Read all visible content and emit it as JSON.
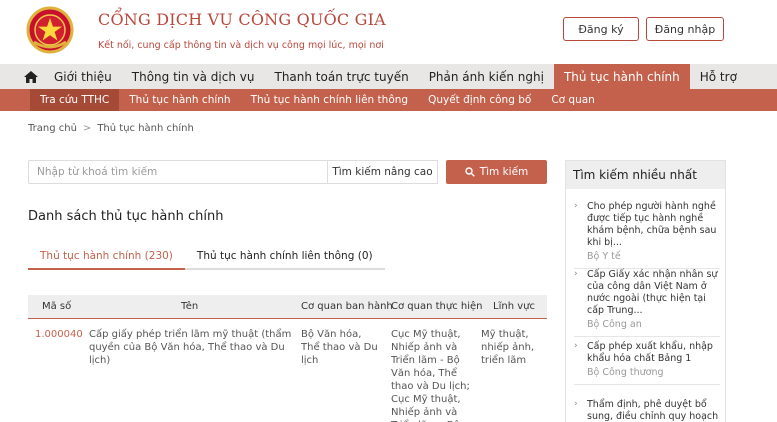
{
  "header": {
    "title": "CỔNG DỊCH VỤ CÔNG QUỐC GIA",
    "subtitle": "Kết nối, cung cấp thông tin và dịch vụ công mọi lúc, mọi nơi",
    "register_label": "Đăng ký",
    "login_label": "Đăng nhập"
  },
  "main_nav": {
    "items": [
      {
        "label": "Giới thiệu"
      },
      {
        "label": "Thông tin và dịch vụ"
      },
      {
        "label": "Thanh toán trực tuyến"
      },
      {
        "label": "Phản ánh kiến nghị"
      },
      {
        "label": "Thủ tục hành chính"
      },
      {
        "label": "Hỗ trợ"
      }
    ]
  },
  "sub_nav": {
    "items": [
      {
        "label": "Tra cứu TTHC"
      },
      {
        "label": "Thủ tục hành chính"
      },
      {
        "label": "Thủ tục hành chính liên thông"
      },
      {
        "label": "Quyết định công bố"
      },
      {
        "label": "Cơ quan"
      }
    ]
  },
  "breadcrumb": {
    "home": "Trang chủ",
    "sep": ">",
    "current": "Thủ tục hành chính"
  },
  "search": {
    "placeholder": "Nhập từ khoá tìm kiếm",
    "advanced_label": "Tìm kiếm nâng cao",
    "button_label": "Tìm kiếm"
  },
  "list": {
    "title": "Danh sách thủ tục hành chính",
    "tabs": [
      {
        "label": "Thủ tục hành chính (230)"
      },
      {
        "label": "Thủ tục hành chính liên thông (0)"
      }
    ],
    "columns": [
      "Mã số",
      "Tên",
      "Cơ quan ban hành",
      "Cơ quan thực hiện",
      "Lĩnh vực"
    ],
    "rows": [
      {
        "code": "1.000040",
        "name": "Cấp giấy phép triển lãm mỹ thuật (thẩm quyền của Bộ Văn hóa, Thể thao và Du lịch)",
        "issuer": "Bộ Văn hóa, Thể thao và Du lịch",
        "executor": "Cục Mỹ thuật, Nhiếp ảnh và Triển lãm - Bộ Văn hóa, Thể thao và Du lịch; Cục Mỹ thuật, Nhiếp ảnh và Triển lãm - Bộ",
        "field": "Mỹ thuật, nhiếp ảnh, triển lãm"
      }
    ]
  },
  "sidebar": {
    "title": "Tìm kiếm nhiều nhất",
    "items": [
      {
        "title": "Cho phép người hành nghề được tiếp tục hành nghề khám bệnh, chữa bệnh sau khi bị...",
        "org": "Bộ Y tế"
      },
      {
        "title": "Cấp Giấy xác nhận nhân sự của công dân Việt Nam ở nước ngoài (thực hiện tại cấp Trung...",
        "org": "Bộ Công an"
      },
      {
        "title": "Cấp phép xuất khẩu, nhập khẩu hóa chất Bảng 1",
        "org": "Bộ Công thương"
      },
      {
        "title": "Thẩm định, phê duyệt bổ sung, điều chỉnh quy hoạch đối với",
        "org": ""
      }
    ]
  },
  "colors": {
    "accent": "#c3614c",
    "accent_dark": "#a54a37",
    "brand_text": "#b9483c"
  },
  "icons": {
    "emblem": "national-emblem-icon",
    "home": "home-icon",
    "search": "search-icon",
    "bullet": "chevron-right-icon"
  }
}
